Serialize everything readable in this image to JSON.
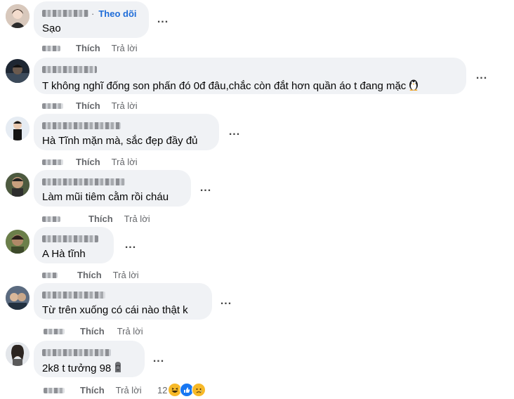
{
  "comments": [
    {
      "author": "T••• g••",
      "follow_label": "Theo dõi",
      "text": "Sạo",
      "like_label": "Thích",
      "reply_label": "Trả lời"
    },
    {
      "text": "T không nghĩ đống son phấn đó 0đ đâu,chắc còn đắt hơn quần áo t đang mặc",
      "emoji": "penguin-icon",
      "like_label": "Thích",
      "reply_label": "Trả lời"
    },
    {
      "text": "Hà Tĩnh mặn mà, sắc đẹp đầy đủ",
      "like_label": "Thích",
      "reply_label": "Trả lời"
    },
    {
      "text": "Làm mũi tiêm cằm rồi cháu",
      "like_label": "Thích",
      "reply_label": "Trả lời"
    },
    {
      "text": "A Hà tĩnh",
      "like_label": "Thích",
      "reply_label": "Trả lời"
    },
    {
      "text": "Từ trên xuống có cái nào thật k",
      "like_label": "Thích",
      "reply_label": "Trả lời"
    },
    {
      "text": "2k8 t tưởng 98",
      "emoji": "moai-icon",
      "like_label": "Thích",
      "reply_label": "Trả lời",
      "reaction_count": "12",
      "reactions": [
        "haha-icon",
        "like-icon",
        "sad-icon"
      ]
    }
  ],
  "more_label": "...",
  "colors": {
    "bubble": "#f0f2f5",
    "follow": "#1e6cd8",
    "meta": "#65676b",
    "like_reaction": "#1877f2",
    "haha_reaction": "#f7b928"
  }
}
